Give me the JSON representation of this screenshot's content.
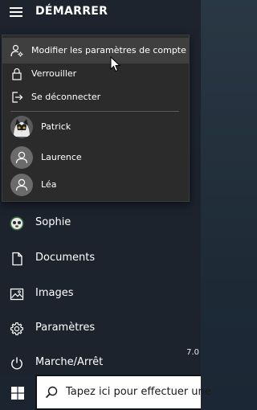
{
  "header": {
    "title": "DÉMARRER",
    "menu_icon": "hamburger-icon"
  },
  "account_menu": {
    "items": [
      {
        "label": "Modifier les paramètres de compte",
        "icon": "account-settings-icon",
        "highlighted": true
      },
      {
        "label": "Verrouiller",
        "icon": "lock-icon",
        "highlighted": false
      },
      {
        "label": "Se déconnecter",
        "icon": "sign-out-icon",
        "highlighted": false
      }
    ],
    "users": [
      {
        "name": "Patrick",
        "avatar": "photo"
      },
      {
        "name": "Laurence",
        "avatar": "default"
      },
      {
        "name": "Léa",
        "avatar": "default"
      }
    ]
  },
  "nav": {
    "items": [
      {
        "label": "Sophie",
        "icon": "user-avatar-icon"
      },
      {
        "label": "Documents",
        "icon": "document-icon"
      },
      {
        "label": "Images",
        "icon": "image-icon"
      },
      {
        "label": "Paramètres",
        "icon": "gear-icon"
      },
      {
        "label": "Marche/Arrêt",
        "icon": "power-icon"
      }
    ]
  },
  "background": {
    "version_text": "7.0"
  },
  "taskbar": {
    "start_icon": "windows-logo-icon",
    "search_placeholder": "Tapez ici pour effectuer une",
    "search_icon": "search-icon"
  },
  "colors": {
    "panel_bg": "#1c232c",
    "menu_bg": "#2b2b2b",
    "highlight_bg": "#3f3f3f",
    "taskbar_bg": "#101418",
    "text": "#ffffff"
  }
}
